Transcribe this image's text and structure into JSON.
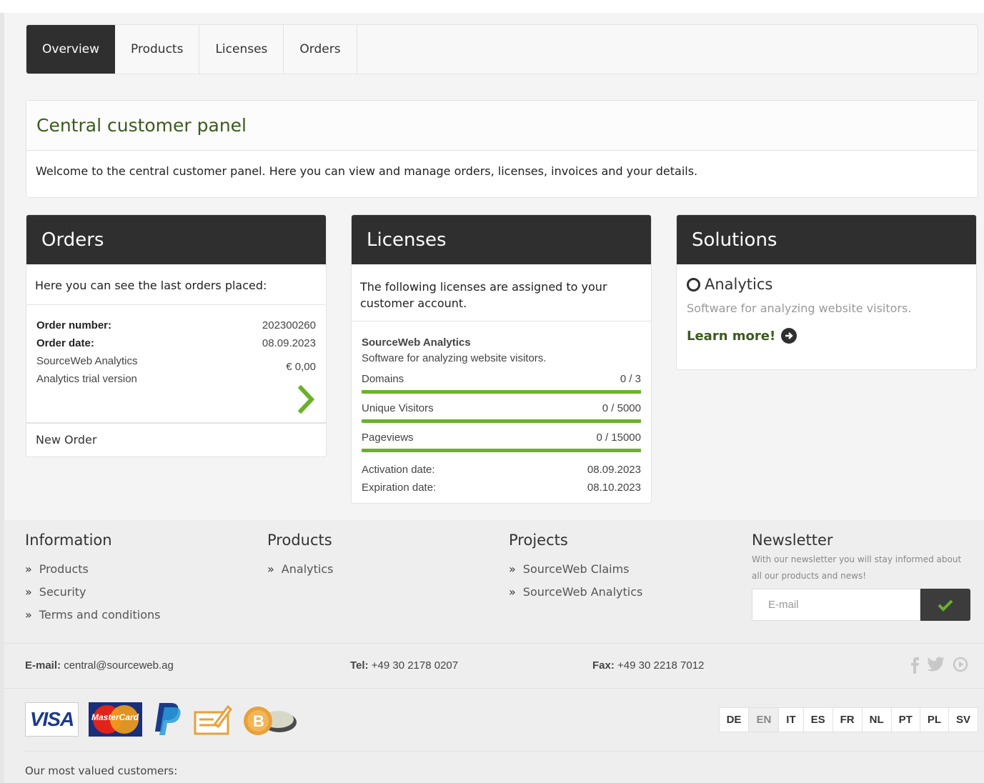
{
  "tabs": [
    {
      "label": "Overview",
      "active": true
    },
    {
      "label": "Products"
    },
    {
      "label": "Licenses"
    },
    {
      "label": "Orders"
    }
  ],
  "central": {
    "title": "Central customer panel",
    "text": "Welcome to the central customer panel. Here you can view and manage orders, licenses, invoices and your details."
  },
  "orders_card": {
    "title": "Orders",
    "intro": "Here you can see the last orders placed:",
    "order_number_label": "Order number:",
    "order_number": "202300260",
    "order_date_label": "Order date:",
    "order_date": "08.09.2023",
    "product": "SourceWeb Analytics",
    "variant": "Analytics trial version",
    "price": "€ 0,00",
    "new_order": "New Order"
  },
  "licenses_card": {
    "title": "Licenses",
    "intro": "The following licenses are assigned to your customer account.",
    "product": "SourceWeb Analytics",
    "description": "Software for analyzing website visitors.",
    "meters": [
      {
        "label": "Domains",
        "value": "0 / 3"
      },
      {
        "label": "Unique Visitors",
        "value": "0 / 5000"
      },
      {
        "label": "Pageviews",
        "value": "0 / 15000"
      }
    ],
    "activation_label": "Activation date:",
    "activation": "08.09.2023",
    "expiration_label": "Expiration date:",
    "expiration": "08.10.2023"
  },
  "solutions_card": {
    "title": "Solutions",
    "item": "Analytics",
    "description": "Software for analyzing website visitors.",
    "learn_more": "Learn more!"
  },
  "footer": {
    "info": {
      "title": "Information",
      "links": [
        "Products",
        "Security",
        "Terms and conditions"
      ]
    },
    "products": {
      "title": "Products",
      "links": [
        "Analytics"
      ]
    },
    "projects": {
      "title": "Projects",
      "links": [
        "SourceWeb Claims",
        "SourceWeb Analytics"
      ]
    },
    "newsletter": {
      "title": "Newsletter",
      "text": "With our newsletter you will stay informed about all our products and news!",
      "placeholder": "E-mail"
    },
    "contact": {
      "email_label": "E-mail:",
      "email": "central@sourceweb.ag",
      "tel_label": "Tel:",
      "tel": "+49 30 2178 0207",
      "fax_label": "Fax:",
      "fax": "+49 30 2218 7012"
    },
    "payments": {
      "visa": "VISA",
      "mastercard": "MasterCard"
    },
    "languages": [
      "DE",
      "EN",
      "IT",
      "ES",
      "FR",
      "NL",
      "PT",
      "PL",
      "SV"
    ],
    "active_language": "EN",
    "valued": "Our most valued customers:"
  },
  "colors": {
    "accent_green": "#6ab12a",
    "dark": "#2f2f2f",
    "title_green": "#3d5a1e"
  }
}
